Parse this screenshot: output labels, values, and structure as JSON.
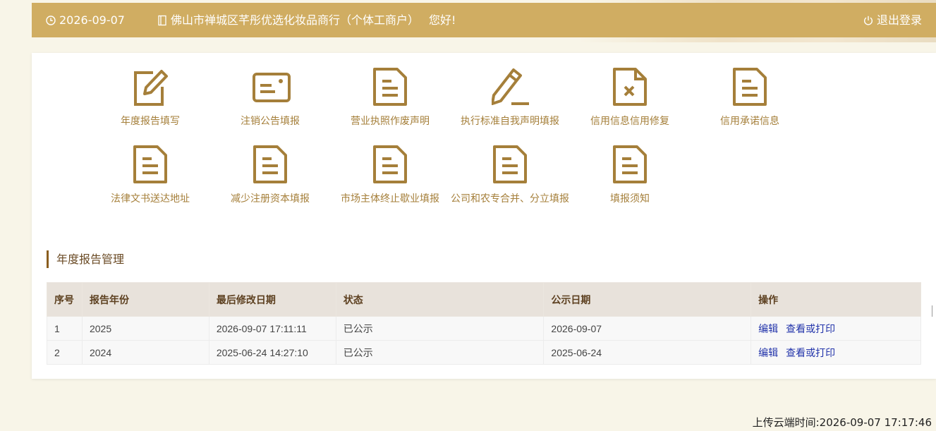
{
  "header": {
    "date": "2026-09-07",
    "company": "佛山市禅城区芊彤优选化妆品商行（个体工商户）",
    "greeting": "您好!",
    "logout": "退出登录"
  },
  "tiles": [
    {
      "label": "年度报告填写",
      "icon": "edit-square-icon"
    },
    {
      "label": "注销公告填报",
      "icon": "card-icon"
    },
    {
      "label": "营业执照作废声明",
      "icon": "document-icon"
    },
    {
      "label": "执行标准自我声明填报",
      "icon": "pencil-icon"
    },
    {
      "label": "信用信息信用修复",
      "icon": "document-x-icon"
    },
    {
      "label": "信用承诺信息",
      "icon": "document-icon"
    },
    {
      "label": "法律文书送达地址",
      "icon": "document-icon"
    },
    {
      "label": "减少注册资本填报",
      "icon": "document-icon"
    },
    {
      "label": "市场主体终止歇业填报",
      "icon": "document-icon"
    },
    {
      "label": "公司和农专合并、分立填报",
      "icon": "document-icon"
    },
    {
      "label": "填报须知",
      "icon": "document-icon"
    }
  ],
  "section": {
    "title": "年度报告管理"
  },
  "table": {
    "headers": [
      "序号",
      "报告年份",
      "最后修改日期",
      "状态",
      "公示日期",
      "操作"
    ],
    "rows": [
      {
        "no": "1",
        "year": "2025",
        "modified": "2026-09-07 17:11:11",
        "status": "已公示",
        "pub_date": "2026-09-07",
        "edit": "编辑",
        "view": "查看或打印"
      },
      {
        "no": "2",
        "year": "2024",
        "modified": "2025-06-24 14:27:10",
        "status": "已公示",
        "pub_date": "2025-06-24",
        "edit": "编辑",
        "view": "查看或打印"
      }
    ]
  },
  "footer": {
    "upload_time": "上传云端时间:2026-09-07 17:17:46"
  },
  "colors": {
    "brand": "#d0ad62",
    "icon": "#a57f3a",
    "link": "#2233aa"
  }
}
